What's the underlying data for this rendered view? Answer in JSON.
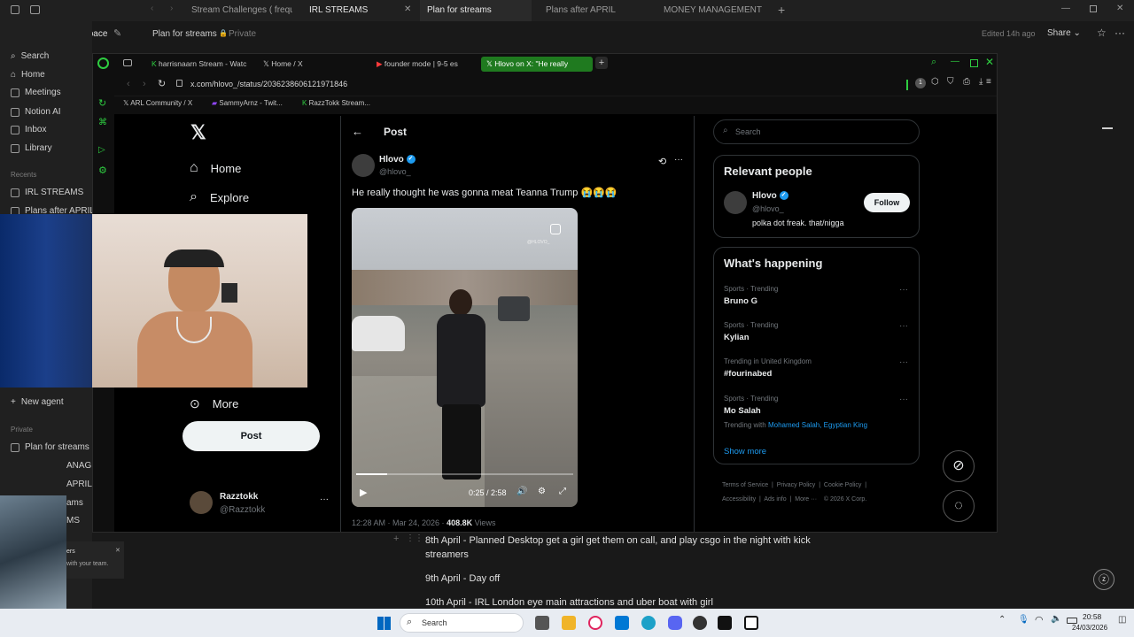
{
  "notion": {
    "tabs": [
      "Stream Challenges ( frequent",
      "IRL STREAMS",
      "Plan for streams",
      "Plans after APRIL",
      "MONEY MANAGEMENT"
    ],
    "workspace": "Rahim Jobe's Space",
    "page_title": "Plan for streams",
    "privacy": "Private",
    "edited": "Edited 14h ago",
    "share": "Share",
    "sidebar_items": [
      "Search",
      "Home",
      "Meetings",
      "Notion AI",
      "Inbox",
      "Library"
    ],
    "recents_label": "Recents",
    "recents": [
      "IRL STREAMS",
      "Plans after APRIL"
    ],
    "new_agent": "New agent",
    "private_label": "Private",
    "private_items": [
      "Plan for streams"
    ],
    "partial_items": [
      "ANAGI",
      "APRIL",
      "ams",
      "MS"
    ],
    "popup_line1": "ers",
    "popup_line2": "with your team.",
    "lines": [
      "8th April - Planned Desktop get a girl get them on call, and play csgo in the night with kick streamers",
      "9th April - Day off",
      "10th April - IRL London eye main attractions and uber boat with girl"
    ]
  },
  "browser": {
    "tabs": [
      "harrisnaarn Stream - Watc",
      "Home / X",
      "founder mode | 9-5 es",
      "Hlovo on X: \"He really"
    ],
    "url": "x.com/hlovo_/status/2036238606121971846",
    "bookmarks": [
      "ARL Community / X",
      "SammyArnz - Twit...",
      "RazzTokk Stream..."
    ],
    "badge": "1"
  },
  "x": {
    "nav": [
      "Home",
      "Explore",
      "More"
    ],
    "post_button": "Post",
    "account_name": "Razztokk",
    "account_handle": "@Razztokk",
    "header": "Post",
    "author_name": "Hlovo",
    "author_handle": "@hlovo_",
    "tweet_text": "He really thought he was gonna meat Teanna Trump 😭😭😭",
    "video_time": "0:25 / 2:58",
    "watermark": "@HLOVO_",
    "timestamp": "12:28 AM · Mar 24, 2026 · ",
    "views_count": "408.8K",
    "views_label": " Views",
    "search_placeholder": "Search",
    "relevant_title": "Relevant people",
    "rel_name": "Hlovo",
    "rel_handle": "@hlovo_",
    "rel_bio": "polka dot freak. that/nigga",
    "follow": "Follow",
    "happening_title": "What's happening",
    "trends": [
      {
        "meta": "Sports · Trending",
        "name": "Bruno G"
      },
      {
        "meta": "Sports · Trending",
        "name": "Kylian"
      },
      {
        "meta": "Trending in United Kingdom",
        "name": "#fourinabed"
      },
      {
        "meta": "Sports · Trending",
        "name": "Mo Salah"
      }
    ],
    "trending_with": "Trending with ",
    "trending_with_links": "Mohamed Salah, Egyptian King",
    "show_more": "Show more",
    "footer": [
      "Terms of Service",
      "Privacy Policy",
      "Cookie Policy",
      "Accessibility",
      "Ads info",
      "More ···",
      "© 2026 X Corp."
    ]
  },
  "taskbar": {
    "search": "Search",
    "time": "20:58",
    "date": "24/03/2026"
  },
  "colors": {
    "opera_green": "#1f7a1f",
    "verified_blue": "#1d9bf0",
    "win_blue": "#0067c0"
  }
}
